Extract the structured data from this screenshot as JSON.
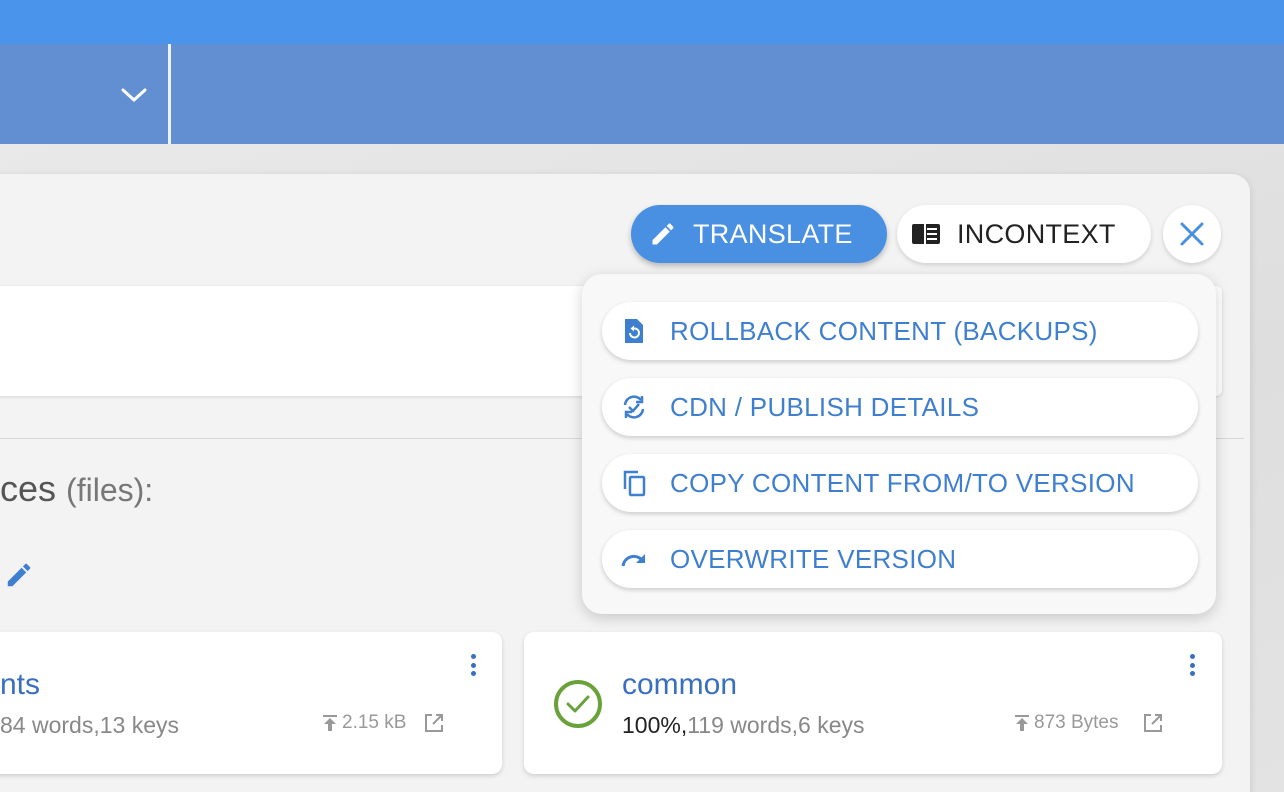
{
  "toolbar": {
    "translate_label": "TRANSLATE",
    "incontext_label": "INCONTEXT"
  },
  "menu": {
    "items": [
      {
        "label": "ROLLBACK CONTENT (BACKUPS)",
        "icon": "file-restore-icon"
      },
      {
        "label": "CDN / PUBLISH DETAILS",
        "icon": "sync-check-icon"
      },
      {
        "label": "COPY CONTENT FROM/TO VERSION",
        "icon": "copy-icon"
      },
      {
        "label": "OVERWRITE VERSION",
        "icon": "redo-arrow-icon"
      }
    ]
  },
  "section": {
    "title": "ces",
    "subtitle": "(files):"
  },
  "cards": [
    {
      "title": "nts",
      "stats": "84 words,13 keys",
      "size": "2.15 kB"
    },
    {
      "title": "common",
      "percent": "100%,",
      "stats": "119 words,6 keys",
      "size": "873 Bytes",
      "status": "complete"
    }
  ],
  "colors": {
    "topbar": "#4a94ec",
    "navbar": "#628fd2",
    "accent": "#4a90e2",
    "link": "#3f7fcf",
    "success": "#6aa13a"
  }
}
